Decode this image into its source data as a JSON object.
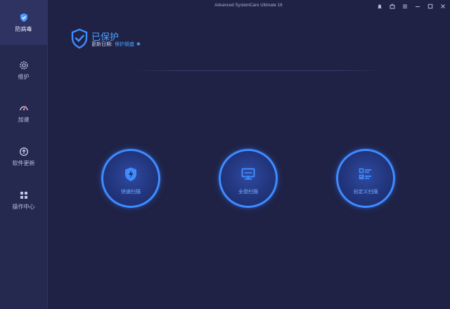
{
  "window": {
    "title": "Advanced SystemCare Ultimate 16"
  },
  "sidebar": {
    "items": [
      {
        "label": "防病毒",
        "icon": "shield-icon",
        "active": true
      },
      {
        "label": "维护",
        "icon": "gear-icon",
        "active": false
      },
      {
        "label": "加速",
        "icon": "speedometer-icon",
        "active": false
      },
      {
        "label": "软件更新",
        "icon": "update-arrow-icon",
        "active": false
      },
      {
        "label": "操作中心",
        "icon": "grid-icon",
        "active": false
      }
    ]
  },
  "status": {
    "title": "已保护",
    "update_label": "更新日期:",
    "update_link": "保护朋盛"
  },
  "scan_buttons": [
    {
      "label": "快速扫描",
      "icon": "lightning-shield-icon"
    },
    {
      "label": "全盘扫描",
      "icon": "monitor-icon"
    },
    {
      "label": "自定义扫描",
      "icon": "checklist-icon"
    }
  ],
  "colors": {
    "background": "#1f2244",
    "sidebar": "#26294f",
    "accent": "#3f8cff",
    "link": "#4fa2ff"
  }
}
